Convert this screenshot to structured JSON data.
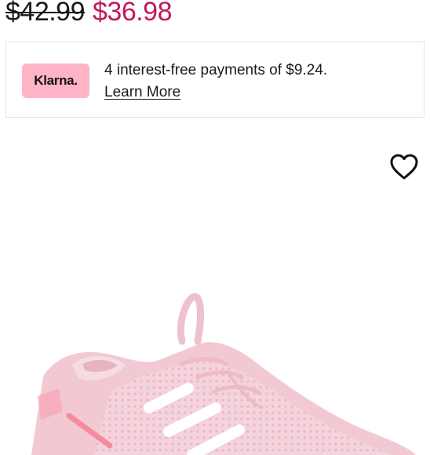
{
  "pricing": {
    "original_price": "$42.99",
    "sale_price": "$36.98"
  },
  "klarna": {
    "logo_text": "Klarna.",
    "message": "4 interest-free payments of $9.24.",
    "link_label": "Learn More"
  },
  "product": {
    "wishlist_icon": "heart-outline-icon",
    "image_icon": "pink-sneaker-photo"
  },
  "colors": {
    "sale_price": "#c2185b",
    "klarna_badge": "#ffb3c7",
    "sneaker": "#f2c9d3",
    "border": "#e3e3e3"
  }
}
